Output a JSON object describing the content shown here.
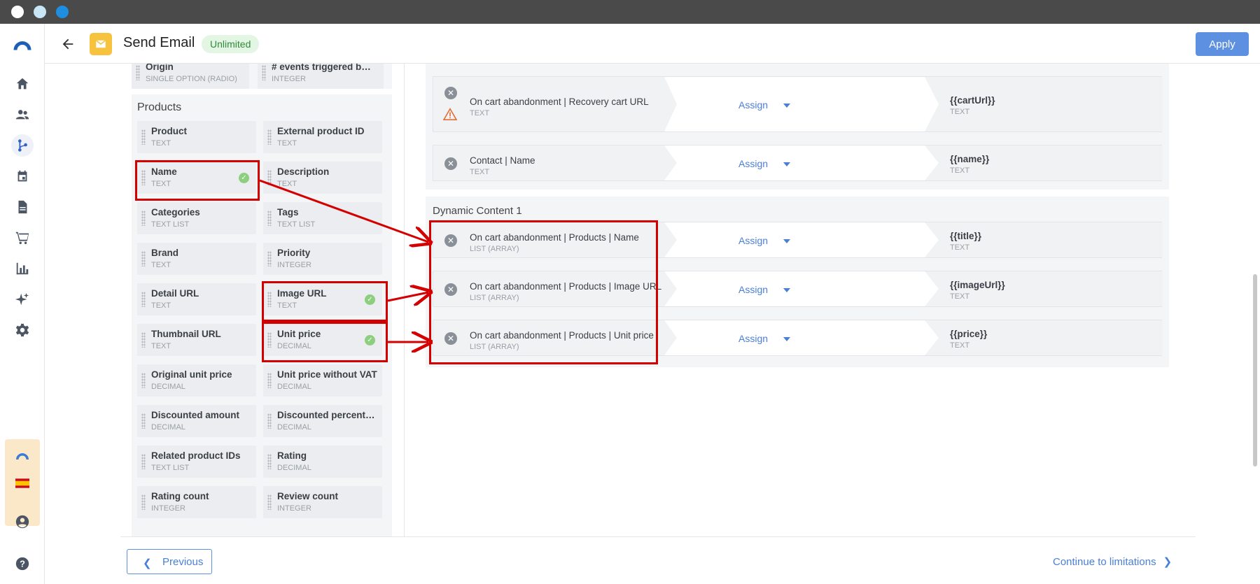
{
  "header": {
    "title": "Send Email",
    "badge": "Unlimited",
    "apply_label": "Apply"
  },
  "left": {
    "top_fields": [
      {
        "name": "Origin",
        "type": "SINGLE OPTION (RADIO)"
      },
      {
        "name": "# events triggered by t...",
        "type": "INTEGER"
      }
    ],
    "group_title": "Products",
    "fields": [
      {
        "name": "Product",
        "type": "TEXT",
        "checked": false
      },
      {
        "name": "External product ID",
        "type": "TEXT",
        "checked": false
      },
      {
        "name": "Name",
        "type": "TEXT",
        "checked": true
      },
      {
        "name": "Description",
        "type": "TEXT",
        "checked": false
      },
      {
        "name": "Categories",
        "type": "TEXT LIST",
        "checked": false
      },
      {
        "name": "Tags",
        "type": "TEXT LIST",
        "checked": false
      },
      {
        "name": "Brand",
        "type": "TEXT",
        "checked": false
      },
      {
        "name": "Priority",
        "type": "INTEGER",
        "checked": false
      },
      {
        "name": "Detail URL",
        "type": "TEXT",
        "checked": false
      },
      {
        "name": "Image URL",
        "type": "TEXT",
        "checked": true
      },
      {
        "name": "Thumbnail URL",
        "type": "TEXT",
        "checked": false
      },
      {
        "name": "Unit price",
        "type": "DECIMAL",
        "checked": true
      },
      {
        "name": "Original unit price",
        "type": "DECIMAL",
        "checked": false
      },
      {
        "name": "Unit price without VAT",
        "type": "DECIMAL",
        "checked": false
      },
      {
        "name": "Discounted amount",
        "type": "DECIMAL",
        "checked": false
      },
      {
        "name": "Discounted percentage",
        "type": "DECIMAL",
        "checked": false
      },
      {
        "name": "Related product IDs",
        "type": "TEXT LIST",
        "checked": false
      },
      {
        "name": "Rating",
        "type": "DECIMAL",
        "checked": false
      },
      {
        "name": "Rating count",
        "type": "INTEGER",
        "checked": false
      },
      {
        "name": "Review count",
        "type": "INTEGER",
        "checked": false
      }
    ]
  },
  "mappings": [
    {
      "source": "On cart abandonment | Recovery cart URL",
      "source_type": "TEXT",
      "action": "Assign",
      "target": "{{cartUrl}}",
      "target_type": "TEXT",
      "warning": true
    },
    {
      "source": "Contact | Name",
      "source_type": "TEXT",
      "action": "Assign",
      "target": "{{name}}",
      "target_type": "TEXT",
      "warning": false
    }
  ],
  "dynamic_content": {
    "title": "Dynamic Content 1",
    "rows": [
      {
        "source": "On cart abandonment | Products | Name",
        "source_type": "LIST (ARRAY)",
        "action": "Assign",
        "target": "{{title}}",
        "target_type": "TEXT"
      },
      {
        "source": "On cart abandonment | Products | Image URL",
        "source_type": "LIST (ARRAY)",
        "action": "Assign",
        "target": "{{imageUrl}}",
        "target_type": "TEXT"
      },
      {
        "source": "On cart abandonment | Products | Unit price",
        "source_type": "LIST (ARRAY)",
        "action": "Assign",
        "target": "{{price}}",
        "target_type": "TEXT"
      }
    ]
  },
  "footer": {
    "previous_label": "Previous",
    "continue_label": "Continue to limitations"
  },
  "sidebar": {
    "icons": [
      "logo-icon",
      "home-icon",
      "contacts-icon",
      "automation-icon",
      "calendar-icon",
      "document-icon",
      "cart-icon",
      "analytics-icon",
      "sparkle-icon",
      "settings-icon",
      "user-icon",
      "help-icon"
    ],
    "active": "automation-icon"
  },
  "colors": {
    "accent": "#5e90e2",
    "highlight_red": "#d40000",
    "check_green": "#8ccf7e",
    "brand_yellow": "#f7c23d"
  }
}
